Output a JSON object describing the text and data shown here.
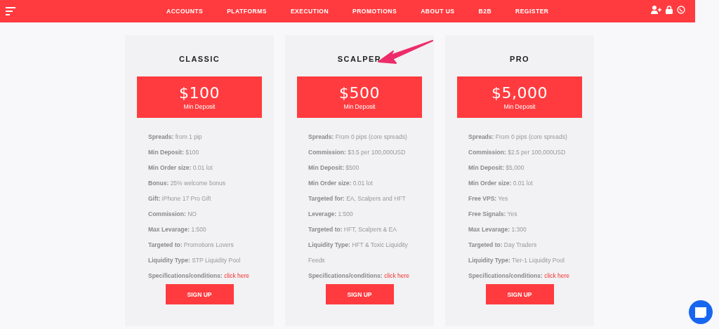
{
  "nav": {
    "items": [
      "ACCOUNTS",
      "PLATFORMS",
      "EXECUTION",
      "PROMOTIONS",
      "ABOUT US",
      "B2B",
      "REGISTER"
    ]
  },
  "plans": [
    {
      "name": "CLASSIC",
      "price": "$100",
      "price_caption": "Min Deposit",
      "features": [
        "**Spreads:** from 1 pip",
        "**Min Deposit:** $100",
        "**Min Order size:** 0.01 lot",
        "**Bonus:** 25% welcome bonus",
        "**Gift:** iPhone 17 Pro Gift",
        "**Commission:** NO",
        "**Max Levarage:** 1:500",
        "**Targeted to:** Promotions Lovers",
        "**Liquidity Type:** STP Liquidity Pool"
      ],
      "spec_label": "Specifications/conditions:",
      "spec_link": "click here",
      "button": "SIGN UP"
    },
    {
      "name": "SCALPER",
      "price": "$500",
      "price_caption": "Min Deposit",
      "features": [
        "**Spreads:** From 0 pips (core spreads)",
        "**Commission:** $3.5 per 100,000USD",
        "**Min Deposit:** $500",
        "**Min Order size:** 0.01 lot",
        "**Targeted for:** EA, Scalpers and HFT",
        "**Leverage:** 1:500",
        "**Targeted to:** HFT, Scalpers & EA",
        "**Liquidity Type:** HFT & Toxic Liquidity Feeds"
      ],
      "spec_label": "Specifications/conditions:",
      "spec_link": "click here",
      "button": "SIGN UP"
    },
    {
      "name": "PRO",
      "price": "$5,000",
      "price_caption": "Min Deposit",
      "features": [
        "**Spreads:** From 0 pips (core spreads)",
        "**Commission:** $2.5 per 100,000USD",
        "**Min Deposit:** $5,000",
        "**Min Order size:** 0.01 lot",
        "**Free VPS:** Yes",
        "**Free Signals:** Yes",
        "**Max Levarage:** 1:300",
        "**Targeted to:** Day Traders",
        "**Liquidity Type:** Tier-1 Liquidity Pool"
      ],
      "spec_label": "Specifications/conditions:",
      "spec_link": "click here",
      "button": "SIGN UP"
    }
  ]
}
